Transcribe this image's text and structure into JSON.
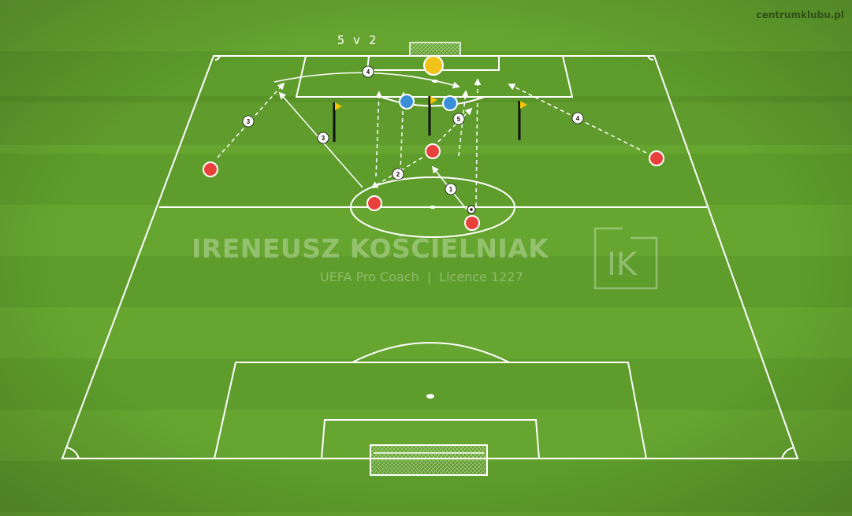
{
  "site": "centrumklubu.pl",
  "drill_title": "5 v 2",
  "watermark": {
    "name": "IRENEUSZ KOŚCIELNIAK",
    "role": "UEFA Pro Coach",
    "separator": "|",
    "licence": "Licence 1227",
    "logo_text": "IK"
  },
  "sequence_labels": [
    "1",
    "2",
    "3",
    "3",
    "4",
    "4",
    "5"
  ],
  "colors": {
    "grass_light": "#6aa832",
    "grass_dark": "#5b9a29",
    "line": "#ffffff",
    "attacker": "#e8413c",
    "defender": "#3a8fd8",
    "goalkeeper": "#f2c318",
    "flag": "#f5c400",
    "pole": "#111111"
  }
}
